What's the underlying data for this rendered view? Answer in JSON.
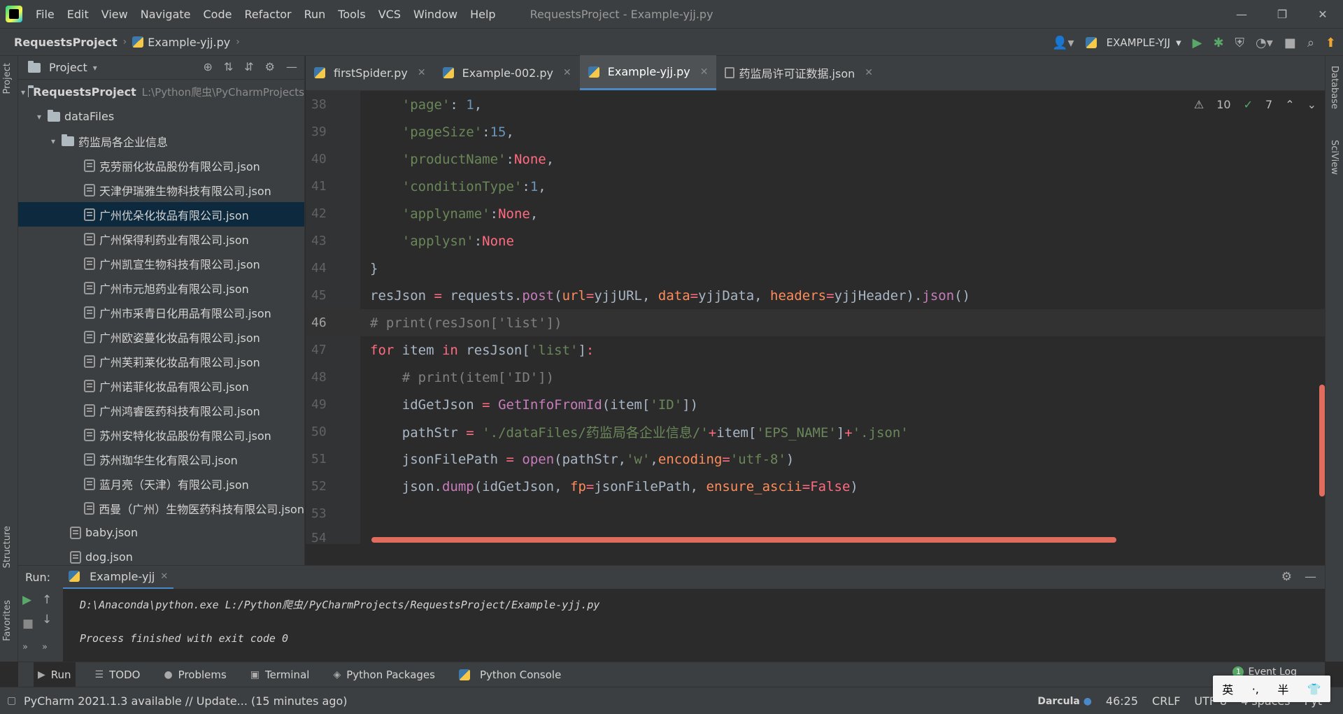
{
  "menubar": {
    "items": [
      "File",
      "Edit",
      "View",
      "Navigate",
      "Code",
      "Refactor",
      "Run",
      "Tools",
      "VCS",
      "Window",
      "Help"
    ],
    "window_title": "RequestsProject - Example-yjj.py"
  },
  "navbar": {
    "project": "RequestsProject",
    "file": "Example-yjj.py",
    "run_config": "EXAMPLE-YJJ"
  },
  "left_stripe": {
    "project": "Project",
    "structure": "Structure",
    "favorites": "Favorites"
  },
  "right_stripe": {
    "database": "Database",
    "sciview": "SciView"
  },
  "project_panel": {
    "title": "Project",
    "root": "RequestsProject",
    "root_path": "L:\\Python爬虫\\PyCharmProjects",
    "data_folder": "dataFiles",
    "sub_folder": "药监局各企业信息",
    "files": [
      "克劳丽化妆品股份有限公司.json",
      "天津伊瑞雅生物科技有限公司.json",
      "广州优朵化妆品有限公司.json",
      "广州保得利药业有限公司.json",
      "广州凯宣生物科技有限公司.json",
      "广州市元旭药业有限公司.json",
      "广州市采青日化用品有限公司.json",
      "广州欧姿蔓化妆品有限公司.json",
      "广州芙莉莱化妆品有限公司.json",
      "广州诺菲化妆品有限公司.json",
      "广州鸿睿医药科技有限公司.json",
      "苏州安特化妆品股份有限公司.json",
      "苏州珈华生化有限公司.json",
      "蓝月亮（天津）有限公司.json",
      "西曼（广州）生物医药科技有限公司.json"
    ],
    "selected_index": 2,
    "other_files": [
      "baby.json",
      "dog.json"
    ]
  },
  "tabs": [
    {
      "label": "firstSpider.py",
      "type": "py"
    },
    {
      "label": "Example-002.py",
      "type": "py"
    },
    {
      "label": "Example-yjj.py",
      "type": "py",
      "active": true
    },
    {
      "label": "药监局许可证数据.json",
      "type": "json"
    }
  ],
  "inspections": {
    "warnings": "10",
    "weak": "7"
  },
  "editor": {
    "current_line": "46",
    "line_numbers": [
      "38",
      "39",
      "40",
      "41",
      "42",
      "43",
      "44",
      "45",
      "46",
      "47",
      "48",
      "49",
      "50",
      "51",
      "52",
      "53",
      "54"
    ]
  },
  "run": {
    "label": "Run:",
    "tab": "Example-yjj",
    "command": "D:\\Anaconda\\python.exe L:/Python爬虫/PyCharmProjects/RequestsProject/Example-yjj.py",
    "result": "Process finished with exit code 0"
  },
  "toolwindows": [
    "Run",
    "TODO",
    "Problems",
    "Terminal",
    "Python Packages",
    "Python Console"
  ],
  "event_log": {
    "count": "1",
    "label": "Event Log"
  },
  "status": {
    "message": "PyCharm 2021.1.3 available // Update... (15 minutes ago)",
    "theme": "Darcula",
    "position": "46:25",
    "line_sep": "CRLF",
    "encoding": "UTF-8",
    "indent": "4 spaces",
    "interpreter": "Pyt"
  },
  "ime": {
    "lang": "英",
    "punct": "·,",
    "width": "半"
  }
}
